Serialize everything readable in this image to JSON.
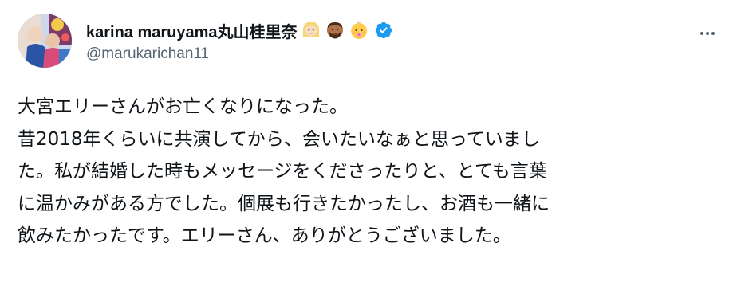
{
  "tweet": {
    "author": {
      "display_name": "karina maruyama丸山桂里奈",
      "handle": "@marukarichan11",
      "emojis": [
        "woman-blond-hair-emoji",
        "man-beard-emoji",
        "baby-emoji"
      ],
      "verified": true
    },
    "body_lines": [
      "大宮エリーさんがお亡くなりになった。",
      "昔2018年くらいに共演してから、会いたいなぁと思っていまし",
      "た。私が結婚した時もメッセージをくださったりと、とても言葉",
      "に温かみがある方でした。個展も行きたかったし、お酒も一緒に",
      "飲みたかったです。エリーさん、ありがとうございました。"
    ]
  },
  "colors": {
    "text_primary": "#0f1419",
    "text_secondary": "#536471",
    "verified_blue": "#1d9bf0"
  },
  "icons": {
    "more": "more-dots-icon",
    "verified": "verified-badge-icon"
  }
}
